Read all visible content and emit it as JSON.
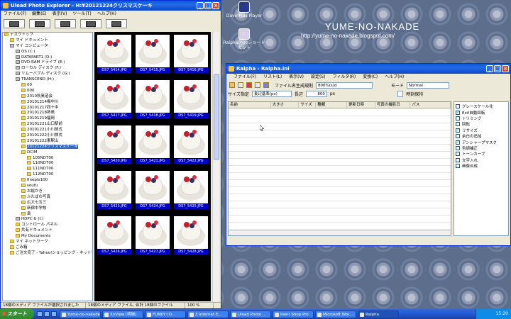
{
  "desktop": {
    "site_title": "YUME-NO-NAKADE",
    "site_url": "http://yume-no-nakade.blogspot.com/",
    "icons": [
      {
        "label": "Dave Plus Player"
      },
      {
        "label": "Ralpha へのショートカット"
      }
    ]
  },
  "explorer": {
    "title": "Ulead Photo Explorer - H:¥20121224クリスマスケーキ",
    "menu": [
      "ファイル(F)",
      "編集(E)",
      "表示(V)",
      "ツール(T)",
      "ヘルプ(H)"
    ],
    "tree": [
      {
        "label": "デスクトップ",
        "indent": 0,
        "drive": false
      },
      {
        "label": "マイ ドキュメント",
        "indent": 1,
        "drive": false
      },
      {
        "label": "マイ コンピュータ",
        "indent": 1,
        "drive": true
      },
      {
        "label": "OS (C:)",
        "indent": 2,
        "drive": true
      },
      {
        "label": "DATAPART1 (D:)",
        "indent": 2,
        "drive": true
      },
      {
        "label": "DVD-RAM ドライブ (E:)",
        "indent": 2,
        "drive": true
      },
      {
        "label": "ローカル ディスク (F:)",
        "indent": 2,
        "drive": true
      },
      {
        "label": "リムーバブル ディスク (G:)",
        "indent": 2,
        "drive": true
      },
      {
        "label": "TRANSCEND (H:)",
        "indent": 2,
        "drive": true
      },
      {
        "label": "00",
        "indent": 3,
        "drive": false
      },
      {
        "label": "000",
        "indent": 3,
        "drive": false
      },
      {
        "label": "2010秋奥道会",
        "indent": 3,
        "drive": false
      },
      {
        "label": "20101214梅中川",
        "indent": 3,
        "drive": false
      },
      {
        "label": "20101217四十中",
        "indent": 3,
        "drive": false
      },
      {
        "label": "20101218熟島",
        "indent": 3,
        "drive": false
      },
      {
        "label": "20101219福岡",
        "indent": 3,
        "drive": false
      },
      {
        "label": "20101221山口駅前",
        "indent": 3,
        "drive": false
      },
      {
        "label": "20101221小川旅式",
        "indent": 3,
        "drive": false
      },
      {
        "label": "20101222小川旅式",
        "indent": 3,
        "drive": false
      },
      {
        "label": "20101222東駅山",
        "indent": 3,
        "drive": false
      },
      {
        "label": "20121224クリスマスケーキ",
        "indent": 3,
        "drive": false,
        "selected": true
      },
      {
        "label": "DCIM",
        "indent": 3,
        "drive": false
      },
      {
        "label": "105ND700",
        "indent": 4,
        "drive": false
      },
      {
        "label": "110ND700",
        "indent": 4,
        "drive": false
      },
      {
        "label": "111ND700",
        "indent": 4,
        "drive": false
      },
      {
        "label": "112ND700",
        "indent": 4,
        "drive": false
      },
      {
        "label": "fineplx100",
        "indent": 3,
        "drive": false
      },
      {
        "label": "soufu",
        "indent": 3,
        "drive": false
      },
      {
        "label": "お絵かき",
        "indent": 3,
        "drive": false
      },
      {
        "label": "ふたばの写真",
        "indent": 3,
        "drive": false
      },
      {
        "label": "広大七五三",
        "indent": 3,
        "drive": false
      },
      {
        "label": "新宿中学校",
        "indent": 3,
        "drive": false
      },
      {
        "label": "島",
        "indent": 3,
        "drive": false
      },
      {
        "label": "HDPC-U (I:)",
        "indent": 2,
        "drive": true
      },
      {
        "label": "コントロール パネル",
        "indent": 2,
        "drive": false
      },
      {
        "label": "共有ドキュメント",
        "indent": 2,
        "drive": false
      },
      {
        "label": "My Documents",
        "indent": 2,
        "drive": false
      },
      {
        "label": "マイ ネットワーク",
        "indent": 1,
        "drive": false
      },
      {
        "label": "ごみ箱",
        "indent": 1,
        "drive": false
      },
      {
        "label": "ご注文完了 - Yahoo!ショッピング - ネットでお買い物",
        "indent": 1,
        "drive": false
      }
    ],
    "thumbnails": [
      "DS7_5414.JPG",
      "DS7_5415.JPG",
      "DS7_5416.JPG",
      "DS7_5417.JPG",
      "DS7_5418.JPG",
      "DS7_5419.JPG",
      "DS7_5420.JPG",
      "DS7_5421.JPG",
      "DS7_5422.JPG",
      "DS7_5423.JPG",
      "DS7_5424.JPG",
      "DS7_5425.JPG",
      "DS7_5426.JPG",
      "DS7_5427.JPG",
      "DS7_5428.JPG"
    ],
    "status": [
      "18個のメディア ファイルが選択されました",
      "18個のメディア ファイル, 合計 18個のファイル",
      "100 %"
    ]
  },
  "ralpha": {
    "title": "Ralpha - Ralpha.ini",
    "menu": [
      "ファイル(F)",
      "リスト(L)",
      "表示(V)",
      "設定(S)",
      "フィルタ(R)",
      "変換(C)",
      "ヘルプ(H)"
    ],
    "filename_label": "ファイル名生成規則",
    "filename_value": "800%(s)d",
    "mode_label": "モード",
    "mode_value": "Normal",
    "size_label": "サイズ指定",
    "size_value": "長辺基準(px)",
    "long_label": "長辺",
    "long_value": "800",
    "unit": "px",
    "keep_time": "時刻保持",
    "columns": [
      "名前",
      "大きさ",
      "サイズ",
      "種類",
      "更新日時",
      "写真の撮影日",
      "パス"
    ],
    "options": [
      {
        "label": "グレースケール化",
        "checked": false
      },
      {
        "label": "Exif自動回転",
        "checked": true
      },
      {
        "label": "トリミング",
        "checked": false
      },
      {
        "label": "回転",
        "checked": false
      },
      {
        "label": "リサイズ",
        "checked": true
      },
      {
        "label": "余白の追加",
        "checked": false
      },
      {
        "label": "アンシャープマスク",
        "checked": true
      },
      {
        "label": "色調補正",
        "checked": false
      },
      {
        "label": "トーンカーブ",
        "checked": false
      },
      {
        "label": "文字入れ",
        "checked": false
      },
      {
        "label": "画像合成",
        "checked": false
      }
    ]
  },
  "taskbar": {
    "start": "スタート",
    "tasks": [
      {
        "label": "Yume-no-nakade",
        "active": false
      },
      {
        "label": "XnView [明晰]",
        "active": false
      },
      {
        "label": "FUNKY☆D...",
        "active": false
      },
      {
        "label": "3 Internet E...",
        "active": false
      },
      {
        "label": "Ulead Photo ...",
        "active": false
      },
      {
        "label": "Paint Shop Pro",
        "active": false
      },
      {
        "label": "Microsoft Wor...",
        "active": false
      },
      {
        "label": "Ralpha",
        "active": true
      }
    ],
    "clock": "15:20"
  }
}
